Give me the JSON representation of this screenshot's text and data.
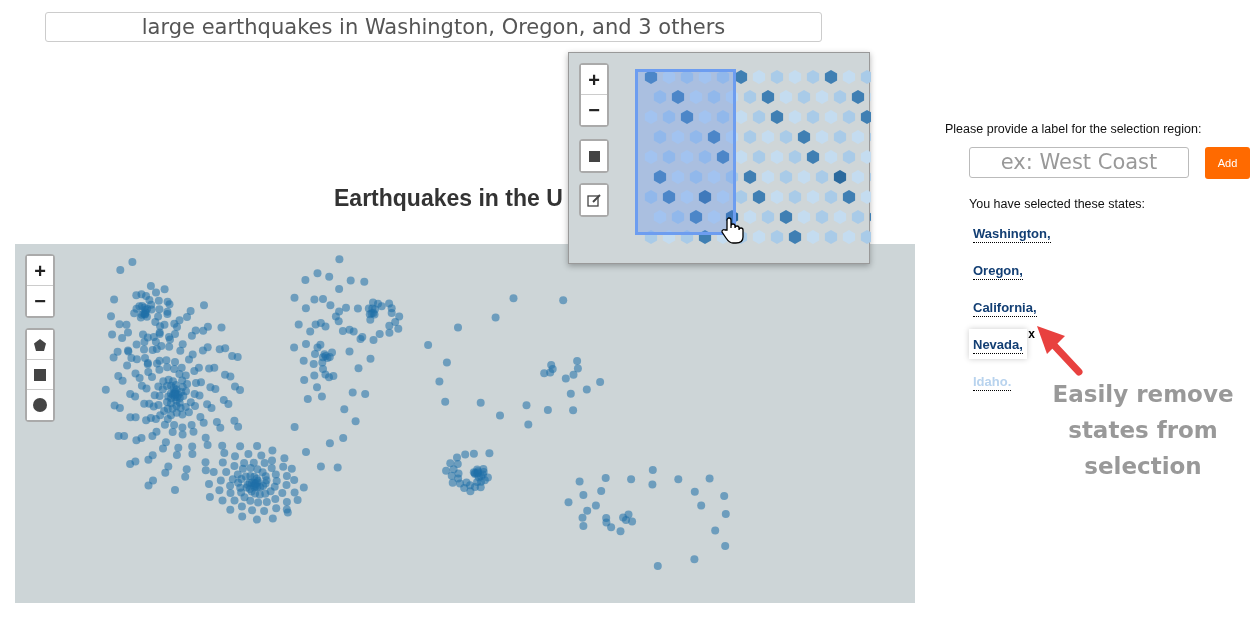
{
  "query_field": {
    "value": "large earthquakes in Washington, Oregon, and 3 others"
  },
  "title": "Earthquakes in the U",
  "map": {
    "zoom_in": "+",
    "zoom_out": "−"
  },
  "inset": {
    "zoom_in": "+",
    "zoom_out": "−"
  },
  "label_panel": {
    "prompt": "Please provide a label for the selection region:",
    "placeholder": "ex: West Coast",
    "add_button": "Add"
  },
  "selection": {
    "heading": "You have selected these states:",
    "remove_mark": "x",
    "states": [
      {
        "label": "Washington,",
        "hovered": false,
        "dimmed": false
      },
      {
        "label": "Oregon,",
        "hovered": false,
        "dimmed": false
      },
      {
        "label": "California,",
        "hovered": false,
        "dimmed": false
      },
      {
        "label": "Nevada,",
        "hovered": true,
        "dimmed": false
      },
      {
        "label": "Idaho.",
        "hovered": false,
        "dimmed": true
      }
    ]
  },
  "annotation": "Easily remove states from selection"
}
